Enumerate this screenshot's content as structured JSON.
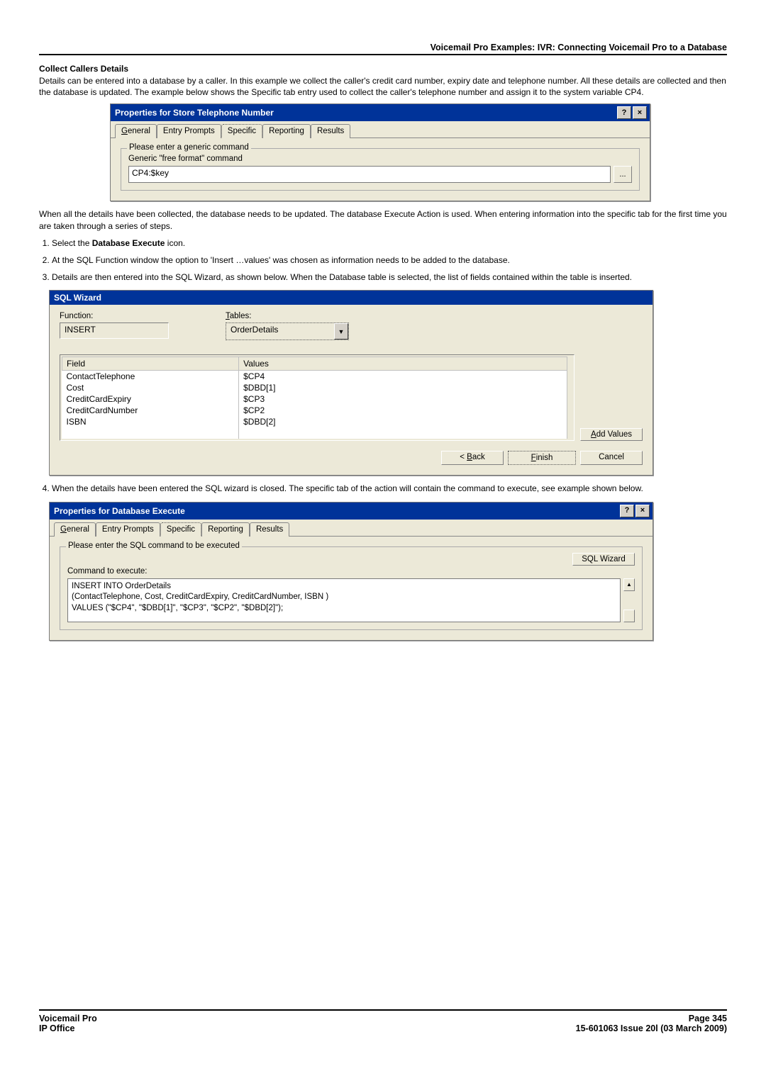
{
  "header": "Voicemail Pro Examples: IVR: Connecting Voicemail Pro to a Database",
  "section_title": "Collect Callers Details",
  "intro_para": "Details can be entered into a database by a caller. In this example we collect the caller's credit card number, expiry date and telephone number. All these details are collected and then the database is updated. The example below shows the Specific tab entry used to collect the caller's telephone number and assign it to the system variable CP4.",
  "dlg1": {
    "title": "Properties for Store Telephone Number",
    "tabs": {
      "general": "General",
      "entry": "Entry Prompts",
      "specific": "Specific",
      "reporting": "Reporting",
      "results": "Results"
    },
    "legend": "Please enter a generic command",
    "label": "Generic \"free format\" command",
    "value": "CP4:$key",
    "more": "..."
  },
  "mid_para": "When all the details have been collected, the database needs to be updated. The database Execute Action is used. When entering information into the specific tab for the first time you are taken through a series of steps.",
  "steps": {
    "s1a": "Select the ",
    "s1b": "Database Execute",
    "s1c": " icon.",
    "s2": "At the SQL Function window the option to 'Insert …values' was chosen as information needs to be added to the database.",
    "s3": "Details are then entered into the SQL Wizard, as shown below. When the Database table is selected, the list of fields contained within the table is inserted.",
    "s4": "When the details have been entered the SQL wizard is closed. The specific tab of the action will contain the command to execute, see example shown below."
  },
  "sql": {
    "title": "SQL Wizard",
    "function_label": "Function:",
    "function_value": "INSERT",
    "tables_label_u": "T",
    "tables_label_rest": "ables:",
    "tables_value": "OrderDetails",
    "grid_headers": {
      "field": "Field",
      "values": "Values"
    },
    "rows": [
      {
        "field": "ContactTelephone",
        "value": "$CP4"
      },
      {
        "field": "Cost",
        "value": "$DBD[1]"
      },
      {
        "field": "CreditCardExpiry",
        "value": "$CP3"
      },
      {
        "field": "CreditCardNumber",
        "value": "$CP2"
      },
      {
        "field": "ISBN",
        "value": "$DBD[2]"
      }
    ],
    "add_btn_u": "A",
    "add_btn_rest": "dd Values",
    "back_u": "B",
    "back_pre": "< ",
    "back_rest": "ack",
    "finish_u": "F",
    "finish_rest": "inish",
    "cancel": "Cancel"
  },
  "dlg2": {
    "title": "Properties for Database Execute",
    "legend": "Please enter the SQL command to be executed",
    "sql_wizard_btn": "SQL Wizard",
    "cmd_label": "Command to execute:",
    "cmd_text": "INSERT INTO OrderDetails\n(ContactTelephone, Cost, CreditCardExpiry, CreditCardNumber, ISBN )\nVALUES  (\"$CP4\", \"$DBD[1]\", \"$CP3\", \"$CP2\", \"$DBD[2]\");"
  },
  "footer": {
    "l1": "Voicemail Pro",
    "l2": "IP Office",
    "r1": "Page 345",
    "r2": "15-601063 Issue 20l (03 March 2009)"
  }
}
